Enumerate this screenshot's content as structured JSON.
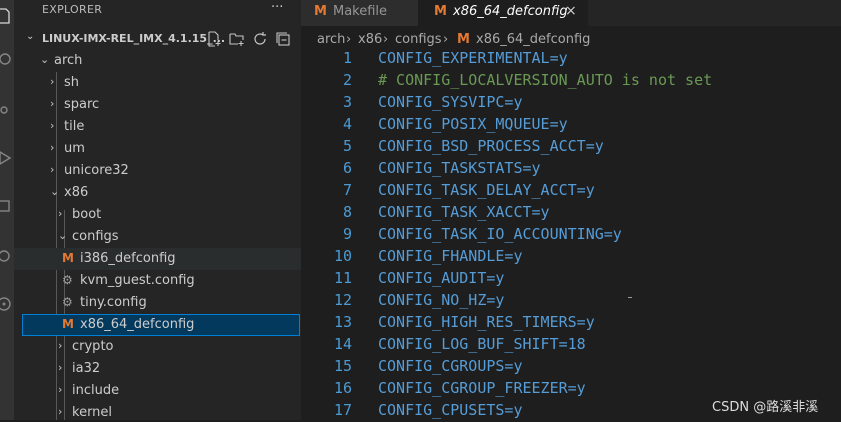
{
  "activity_bar": {
    "icons": [
      "files-icon",
      "search-icon",
      "source-control-icon",
      "run-debug-icon",
      "extensions-icon",
      "remote-explorer-icon",
      "account-icon"
    ]
  },
  "sidebar": {
    "title": "EXPLORER",
    "more": "···",
    "root_label": "LINUX-IMX-REL_IMX_4.1.15_...",
    "root_actions": [
      "new-file-icon",
      "new-folder-icon",
      "refresh-icon",
      "collapse-all-icon"
    ],
    "tree": [
      {
        "label": "arch",
        "type": "folder",
        "expanded": true
      },
      {
        "label": "sh",
        "type": "folder",
        "expanded": false
      },
      {
        "label": "sparc",
        "type": "folder",
        "expanded": false
      },
      {
        "label": "tile",
        "type": "folder",
        "expanded": false
      },
      {
        "label": "um",
        "type": "folder",
        "expanded": false
      },
      {
        "label": "unicore32",
        "type": "folder",
        "expanded": false
      },
      {
        "label": "x86",
        "type": "folder",
        "expanded": true
      },
      {
        "label": "boot",
        "type": "folder",
        "expanded": false
      },
      {
        "label": "configs",
        "type": "folder",
        "expanded": true
      },
      {
        "label": "i386_defconfig",
        "type": "makefile"
      },
      {
        "label": "kvm_guest.config",
        "type": "config"
      },
      {
        "label": "tiny.config",
        "type": "config"
      },
      {
        "label": "x86_64_defconfig",
        "type": "makefile",
        "selected": true
      },
      {
        "label": "crypto",
        "type": "folder",
        "expanded": false
      },
      {
        "label": "ia32",
        "type": "folder",
        "expanded": false
      },
      {
        "label": "include",
        "type": "folder",
        "expanded": false
      },
      {
        "label": "kernel",
        "type": "folder",
        "expanded": false
      }
    ]
  },
  "tabs": [
    {
      "label": "Makefile",
      "icon": "M",
      "active": false
    },
    {
      "label": "x86_64_defconfig",
      "icon": "M",
      "active": true,
      "close": "×"
    }
  ],
  "breadcrumbs": [
    "arch",
    "x86",
    "configs",
    "x86_64_defconfig"
  ],
  "breadcrumb_sep": "›",
  "breadcrumb_icon": "M",
  "code_lines": [
    {
      "n": "1",
      "text": "CONFIG_EXPERIMENTAL=y",
      "comment": false
    },
    {
      "n": "2",
      "text": "# CONFIG_LOCALVERSION_AUTO is not set",
      "comment": true
    },
    {
      "n": "3",
      "text": "CONFIG_SYSVIPC=y",
      "comment": false
    },
    {
      "n": "4",
      "text": "CONFIG_POSIX_MQUEUE=y",
      "comment": false
    },
    {
      "n": "5",
      "text": "CONFIG_BSD_PROCESS_ACCT=y",
      "comment": false
    },
    {
      "n": "6",
      "text": "CONFIG_TASKSTATS=y",
      "comment": false
    },
    {
      "n": "7",
      "text": "CONFIG_TASK_DELAY_ACCT=y",
      "comment": false
    },
    {
      "n": "8",
      "text": "CONFIG_TASK_XACCT=y",
      "comment": false
    },
    {
      "n": "9",
      "text": "CONFIG_TASK_IO_ACCOUNTING=y",
      "comment": false
    },
    {
      "n": "10",
      "text": "CONFIG_FHANDLE=y",
      "comment": false
    },
    {
      "n": "11",
      "text": "CONFIG_AUDIT=y",
      "comment": false
    },
    {
      "n": "12",
      "text": "CONFIG_NO_HZ=y",
      "comment": false
    },
    {
      "n": "13",
      "text": "CONFIG_HIGH_RES_TIMERS=y",
      "comment": false
    },
    {
      "n": "14",
      "text": "CONFIG_LOG_BUF_SHIFT=18",
      "comment": false
    },
    {
      "n": "15",
      "text": "CONFIG_CGROUPS=y",
      "comment": false
    },
    {
      "n": "16",
      "text": "CONFIG_CGROUP_FREEZER=y",
      "comment": false
    },
    {
      "n": "17",
      "text": "CONFIG_CPUSETS=y",
      "comment": false
    }
  ],
  "watermark": "CSDN @路溪非溪",
  "colors": {
    "keyword": "#569cd6",
    "comment": "#6a9955",
    "line_number": "#4a9bd4",
    "makefile_icon": "#e37933",
    "selection": "#04395e"
  }
}
